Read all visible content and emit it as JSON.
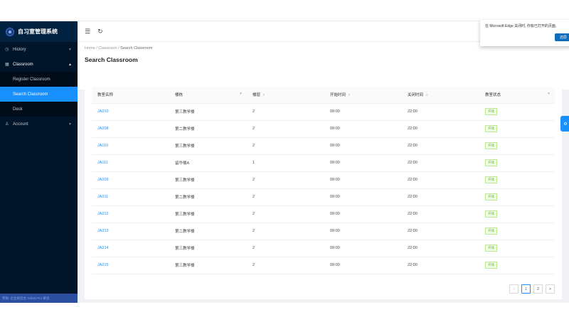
{
  "app": {
    "title": "自习室管理系统"
  },
  "sidebar": {
    "items": [
      {
        "label": "History",
        "icon": "clock-icon"
      },
      {
        "label": "Classroom",
        "icon": "calendar-icon"
      }
    ],
    "submenu": [
      {
        "label": "Register Classroom"
      },
      {
        "label": "Search Classroom",
        "active": true
      },
      {
        "label": "Desk"
      }
    ],
    "account": {
      "label": "Account",
      "icon": "user-icon"
    },
    "footer": "赞助: 企业级后台 Admin Pro 解读"
  },
  "header": {
    "collapse_icon": "menu-fold-icon",
    "reload_icon": "reload-icon"
  },
  "breadcrumb": [
    "Home",
    "Classroom",
    "Search Classroom"
  ],
  "page_title": "Search Classroom",
  "table": {
    "columns": [
      "教室名称",
      "楼栋",
      "楼层",
      "开始时间",
      "关闭时间",
      "教室状态"
    ],
    "rows": [
      [
        "JA210",
        "第三教学楼",
        "2",
        "09:00",
        "22:00",
        "开放"
      ],
      [
        "JA208",
        "第二教学楼",
        "2",
        "09:00",
        "22:00",
        "开放"
      ],
      [
        "JA110",
        "第三教学楼",
        "2",
        "09:00",
        "22:00",
        "开放"
      ],
      [
        "JA111",
        "留华楼A",
        "1",
        "09:00",
        "22:00",
        "开放"
      ],
      [
        "JA209",
        "第三教学楼",
        "2",
        "09:00",
        "22:00",
        "开放"
      ],
      [
        "JA211",
        "第二教学楼",
        "2",
        "09:00",
        "22:00",
        "开放"
      ],
      [
        "JA212",
        "第三教学楼",
        "2",
        "09:00",
        "22:00",
        "开放"
      ],
      [
        "JA213",
        "第二教学楼",
        "2",
        "09:00",
        "22:00",
        "开放"
      ],
      [
        "JA214",
        "第三教学楼",
        "2",
        "09:00",
        "22:00",
        "开放"
      ],
      [
        "JA215",
        "第三教学楼",
        "2",
        "09:00",
        "22:00",
        "开放"
      ]
    ]
  },
  "pagination": {
    "prev": "<",
    "pages": [
      "1",
      "2"
    ],
    "next": ">",
    "current": "1"
  },
  "popup": {
    "text": "在 Microsoft Edge 关闭时, 你有已打开的页面,",
    "button": "还原"
  },
  "colors": {
    "sidebar_bg": "#001529",
    "accent": "#1890ff",
    "tag_green": "#52c41a"
  }
}
